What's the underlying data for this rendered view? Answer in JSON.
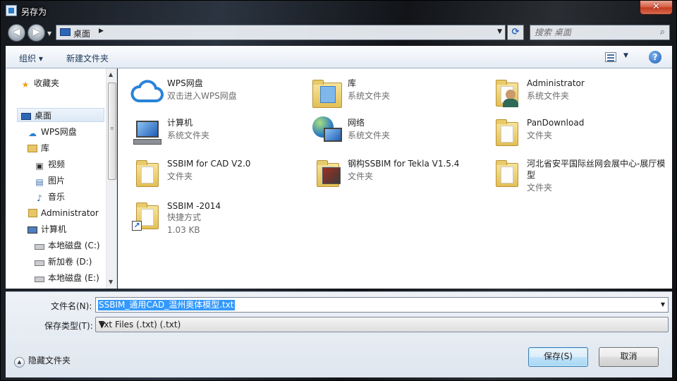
{
  "window": {
    "title": "另存为",
    "close_label": "✕"
  },
  "nav": {
    "back": "◀",
    "forward": "▶",
    "breadcrumb": "桌面",
    "crumb_arrow": "▶",
    "search_placeholder": "搜索 桌面"
  },
  "toolbar": {
    "organize": "组织 ▾",
    "new_folder": "新建文件夹",
    "help": "?"
  },
  "sidebar": {
    "items": [
      {
        "label": "收藏夹",
        "icon": "star-icon"
      },
      {
        "label": "桌面",
        "icon": "desktop-icon"
      },
      {
        "label": "WPS网盘",
        "icon": "cloud-icon"
      },
      {
        "label": "库",
        "icon": "library-icon"
      },
      {
        "label": "视频",
        "icon": "video-icon"
      },
      {
        "label": "图片",
        "icon": "picture-icon"
      },
      {
        "label": "音乐",
        "icon": "music-icon"
      },
      {
        "label": "Administrator",
        "icon": "user-folder-icon"
      },
      {
        "label": "计算机",
        "icon": "computer-icon"
      },
      {
        "label": "本地磁盘 (C:)",
        "icon": "system-drive-icon"
      },
      {
        "label": "新加卷 (D:)",
        "icon": "drive-icon"
      },
      {
        "label": "本地磁盘 (E:)",
        "icon": "drive-icon"
      }
    ]
  },
  "files": [
    {
      "name": "WPS网盘",
      "sub": "双击进入WPS网盘",
      "icon": "cloud-icon"
    },
    {
      "name": "库",
      "sub": "系统文件夹",
      "icon": "library-icon"
    },
    {
      "name": "Administrator",
      "sub": "系统文件夹",
      "icon": "user-folder-icon"
    },
    {
      "name": "计算机",
      "sub": "系统文件夹",
      "icon": "computer-icon"
    },
    {
      "name": "网络",
      "sub": "系统文件夹",
      "icon": "network-icon"
    },
    {
      "name": "PanDownload",
      "sub": "文件夹",
      "icon": "folder-icon"
    },
    {
      "name": "SSBIM for CAD V2.0",
      "sub": "文件夹",
      "icon": "folder-icon"
    },
    {
      "name": "钢构SSBIM for Tekla V1.5.4",
      "sub": "文件夹",
      "icon": "folder-icon"
    },
    {
      "name": "河北省安平国际丝网会展中心-展厅模型",
      "sub": "文件夹",
      "icon": "folder-icon"
    },
    {
      "name": "SSBIM -2014",
      "sub": "快捷方式",
      "sub2": "1.03 KB",
      "icon": "shortcut-folder-icon"
    }
  ],
  "footer": {
    "filename_label": "文件名(N):",
    "filename_value": "SSBIM_通用CAD_温州奥体模型.txt",
    "filetype_label": "保存类型(T):",
    "filetype_value": "Txt Files (.txt) (.txt)",
    "hide_folders": "隐藏文件夹",
    "save": "保存(S)",
    "cancel": "取消"
  }
}
